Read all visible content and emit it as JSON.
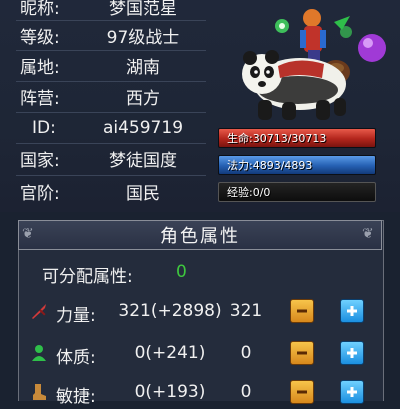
{
  "profile": {
    "nickname_label": "昵称:",
    "nickname_value": "梦国范星",
    "level_label": "等级:",
    "level_value": "97级战士",
    "region_label": "属地:",
    "region_value": "湖南",
    "faction_label": "阵营:",
    "faction_value": "西方",
    "id_label": "ID:",
    "id_value": "ai459719",
    "country_label": "国家:",
    "country_value": "梦徒国度",
    "rank_label": "官阶:",
    "rank_value": "国民"
  },
  "stats": {
    "hp_text": "生命:30713/30713",
    "mp_text": "法力:4893/4893",
    "xp_text": "经验:0/0",
    "hp_fill": 1.0,
    "mp_fill": 1.0,
    "xp_fill": 0.0
  },
  "attributes": {
    "title": "角色属性",
    "free_label": "可分配属性:",
    "free_value": "0",
    "rows": [
      {
        "icon": "sword-icon",
        "name": "力量:",
        "value": "321(+2898)",
        "alloc": "321"
      },
      {
        "icon": "person-icon",
        "name": "体质:",
        "value": "0(+241)",
        "alloc": "0"
      },
      {
        "icon": "boot-icon",
        "name": "敏捷:",
        "value": "0(+193)",
        "alloc": "0"
      }
    ]
  },
  "colors": {
    "hp_bar": "#b2251c",
    "mp_bar": "#2560b2",
    "free_points": "#3ec83e",
    "minus_button": "#d7881c",
    "plus_button": "#1b8fe0"
  }
}
